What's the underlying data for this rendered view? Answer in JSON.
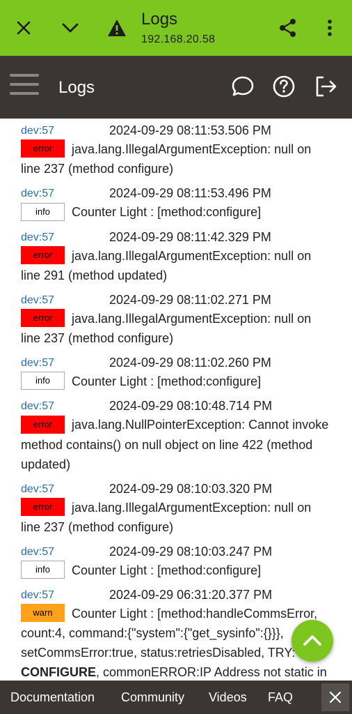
{
  "browser": {
    "title": "Logs",
    "url": "192.168.20.58",
    "icons": [
      "close-icon",
      "chevron-down-icon",
      "warning-icon",
      "share-icon",
      "more-vert-icon"
    ]
  },
  "header": {
    "title": "Logs",
    "icons": [
      "menu-icon",
      "chat-icon",
      "help-icon",
      "logout-icon"
    ]
  },
  "logs": [
    {
      "dev": "dev:57",
      "time": "2024-09-29 08:11:53.506 PM",
      "level": "error",
      "message": "java.lang.IllegalArgumentException: null on line 237 (method configure)"
    },
    {
      "dev": "dev:57",
      "time": "2024-09-29 08:11:53.496 PM",
      "level": "info",
      "message": "Counter Light : [method:configure]"
    },
    {
      "dev": "dev:57",
      "time": "2024-09-29 08:11:42.329 PM",
      "level": "error",
      "message": "java.lang.IllegalArgumentException: null on line 291 (method updated)"
    },
    {
      "dev": "dev:57",
      "time": "2024-09-29 08:11:02.271 PM",
      "level": "error",
      "message": "java.lang.IllegalArgumentException: null on line 237 (method configure)"
    },
    {
      "dev": "dev:57",
      "time": "2024-09-29 08:11:02.260 PM",
      "level": "info",
      "message": "Counter Light : [method:configure]"
    },
    {
      "dev": "dev:57",
      "time": "2024-09-29 08:10:48.714 PM",
      "level": "error",
      "message": "java.lang.NullPointerException: Cannot invoke method contains() on null object on line 422 (method updated)"
    },
    {
      "dev": "dev:57",
      "time": "2024-09-29 08:10:03.320 PM",
      "level": "error",
      "message": "java.lang.IllegalArgumentException: null on line 237 (method configure)"
    },
    {
      "dev": "dev:57",
      "time": "2024-09-29 08:10:03.247 PM",
      "level": "info",
      "message": "Counter Light : [method:configure]"
    },
    {
      "dev": "dev:57",
      "time": "2024-09-29 06:31:20.377 PM",
      "level": "warn",
      "message": "Counter Light : [method:handleCommsError, count:4, command:{\"system\":{\"get_sysinfo\":{}}}, setCommsError:true, status:retriesDisabled, TRY: ",
      "bold": "CONFIGURE",
      "message_tail": ", commonERROR:IP Address not static in Router]"
    }
  ],
  "fab": {
    "icon": "chevron-up-icon"
  },
  "footer": {
    "links": [
      "Documentation",
      "Community",
      "Videos",
      "FAQ"
    ],
    "close_icon": "close-icon"
  },
  "colors": {
    "accent": "#7dc61f",
    "header_bg": "#3b3633",
    "error": "#ff0000",
    "warn": "#ffa21a",
    "dev_link": "#2a6ca8"
  }
}
